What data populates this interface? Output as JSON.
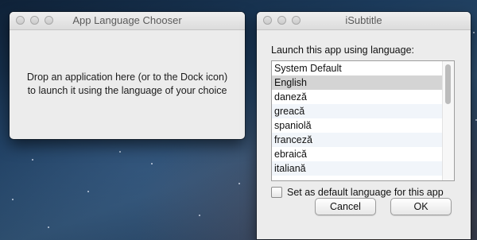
{
  "window1": {
    "title": "App Language Chooser",
    "message_line1": "Drop an application here (or to the Dock icon)",
    "message_line2": "to launch it using the language of your choice"
  },
  "window2": {
    "title": "iSubtitle",
    "prompt": "Launch this app using language:",
    "languages": [
      "System Default",
      "English",
      "daneză",
      "greacă",
      "spaniolă",
      "franceză",
      "ebraică",
      "italiană"
    ],
    "selected_index": 1,
    "checkbox_label": "Set as default language for this app",
    "checkbox_checked": false,
    "cancel_label": "Cancel",
    "ok_label": "OK"
  }
}
